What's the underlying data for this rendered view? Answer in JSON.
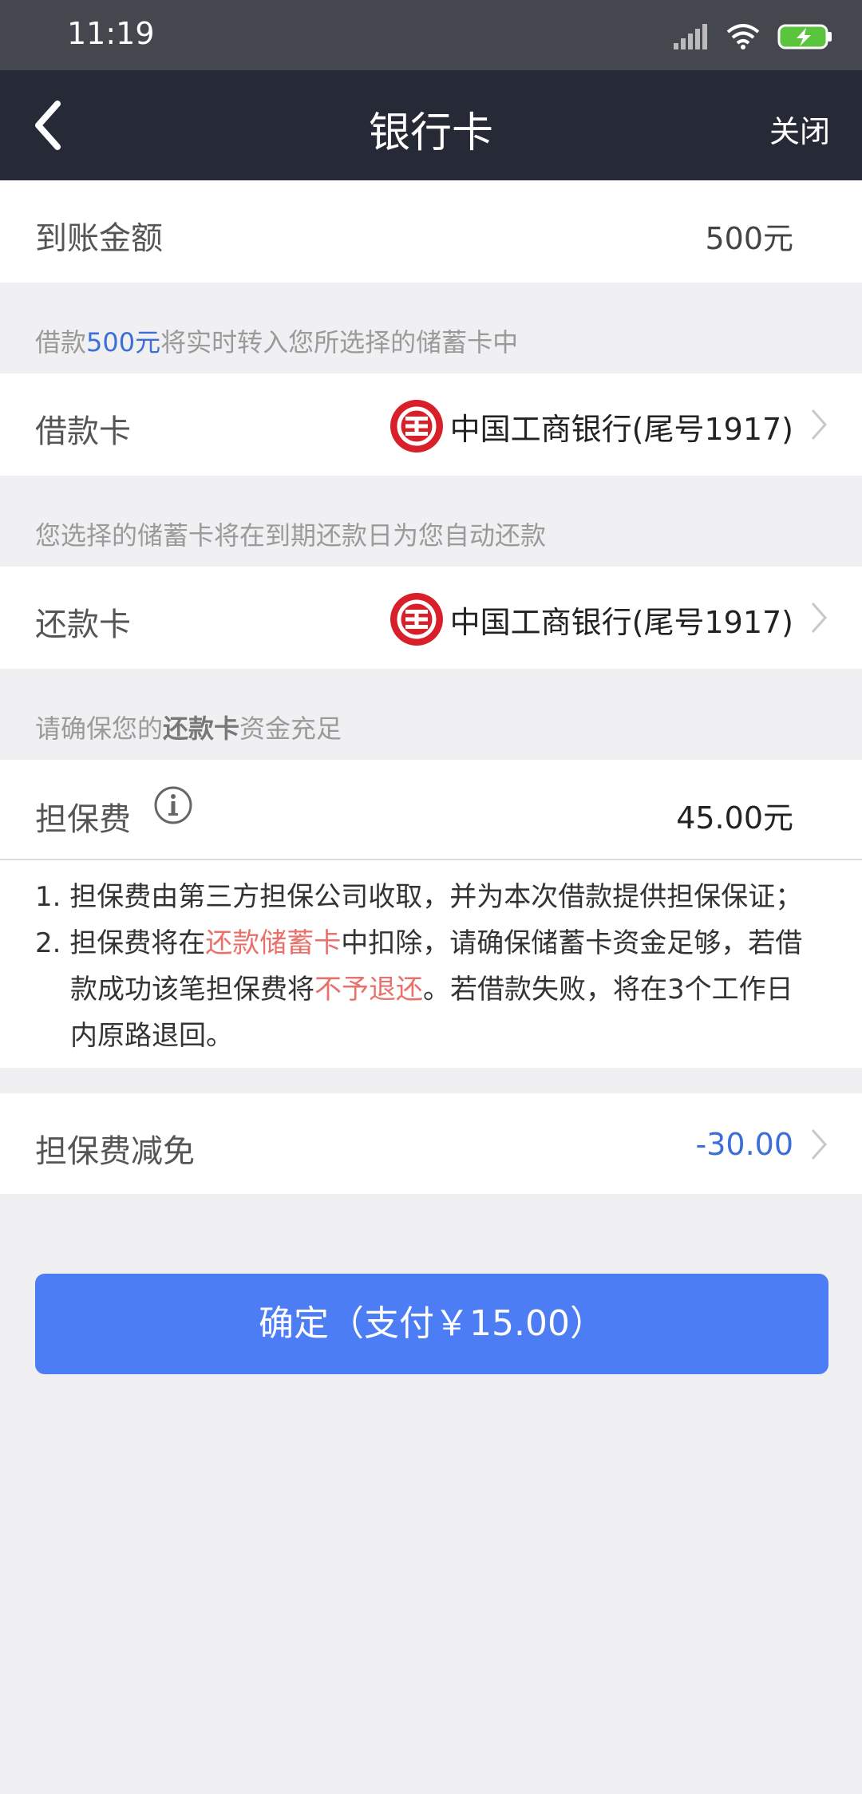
{
  "status_bar": {
    "time": "11:19"
  },
  "nav": {
    "title": "银行卡",
    "close_label": "关闭"
  },
  "amount_row": {
    "label": "到账金额",
    "value": "500元"
  },
  "loan_note": {
    "prefix": "借款",
    "amount": "500元",
    "suffix": "将实时转入您所选择的储蓄卡中"
  },
  "loan_card": {
    "label": "借款卡",
    "bank": "中国工商银行(尾号1917)"
  },
  "repay_note": "您选择的储蓄卡将在到期还款日为您自动还款",
  "repay_card": {
    "label": "还款卡",
    "bank": "中国工商银行(尾号1917)"
  },
  "funds_note": {
    "prefix": "请确保您的",
    "bold": "还款卡",
    "suffix": "资金充足"
  },
  "guarantee_fee": {
    "label": "担保费",
    "value": "45.00元"
  },
  "terms": {
    "line1": "1. 担保费由第三方担保公司收取，并为本次借款提供担保保证；",
    "line2_a": "2. 担保费将在",
    "line2_red": "还款储蓄卡",
    "line2_b": "中扣除，请确保储蓄卡资金足够，若借",
    "line3_a": "款成功该笔担保费将",
    "line3_red": "不予退还",
    "line3_b": "。若借款失败，将在3个工作日",
    "line4": "内原路退回。"
  },
  "fee_discount": {
    "label": "担保费减免",
    "value": "-30.00"
  },
  "confirm_button": "确定（支付￥15.00）",
  "colors": {
    "accent": "#4c7df4",
    "link_blue": "#3b6ed8",
    "warning_red": "#e8716b",
    "bank_red": "#d7202a",
    "nav_bg": "#262936"
  }
}
